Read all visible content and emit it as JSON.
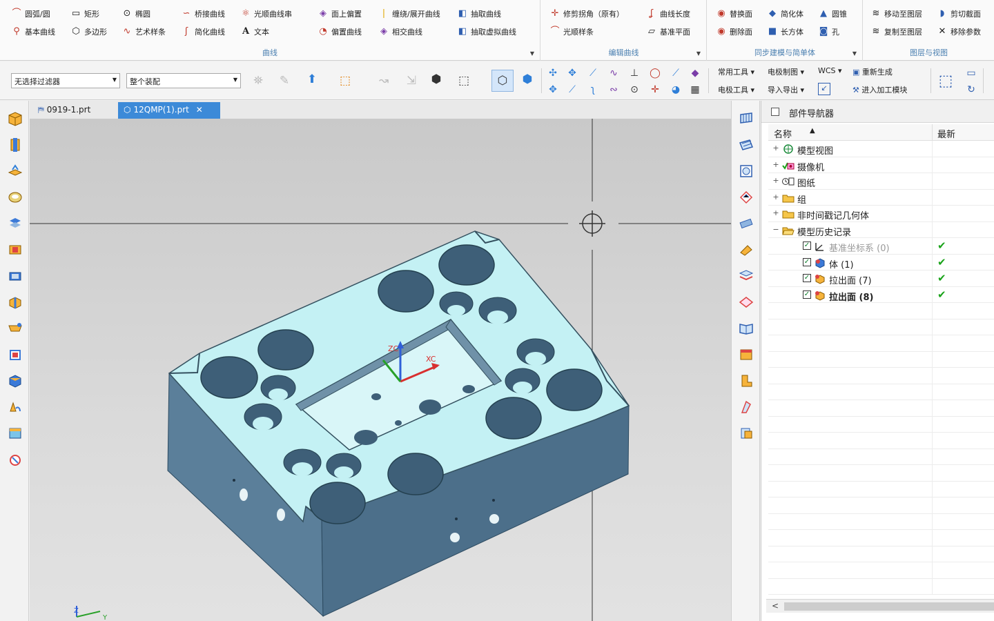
{
  "ribbon": {
    "groups": [
      {
        "title": "曲线",
        "row1": [
          "圆弧/圆",
          "矩形",
          "椭圆",
          "桥接曲线",
          "光顺曲线串",
          "面上偏置",
          "缠绕/展开曲线",
          "抽取曲线"
        ],
        "row2": [
          "基本曲线",
          "多边形",
          "艺术样条",
          "简化曲线",
          "文本",
          "偏置曲线",
          "相交曲线",
          "抽取虚拟曲线"
        ]
      },
      {
        "title": "编辑曲线",
        "row1": [
          "修剪拐角（原有）",
          "曲线长度"
        ],
        "row2": [
          "光顺样条",
          "基准平面"
        ]
      },
      {
        "title": "同步建模与简单体",
        "row1": [
          "替换面",
          "简化体",
          "圆锥"
        ],
        "row2": [
          "删除面",
          "长方体",
          "孔"
        ]
      },
      {
        "title": "图层与视图",
        "row1": [
          "移动至图层",
          "剪切截面"
        ],
        "row2": [
          "复制至图层",
          "移除参数"
        ]
      }
    ]
  },
  "toolbar": {
    "filter_combo": "无选择过滤器",
    "scope_combo": "整个装配",
    "menus_row1": [
      "常用工具",
      "电极制图",
      "WCS"
    ],
    "menus_row2": [
      "电极工具",
      "导入导出"
    ],
    "regen_label": "重新生成",
    "enter_machining_label": "进入加工模块"
  },
  "tabs": [
    {
      "label": "0919-1.prt",
      "active": false
    },
    {
      "label": "12QMP(1).prt",
      "active": true,
      "close": "✕"
    }
  ],
  "viewport": {
    "axis_zc": "ZC",
    "axis_xc": "XC",
    "corner_z": "Z",
    "corner_y": "Y"
  },
  "navigator": {
    "title": "部件导航器",
    "col_name": "名称",
    "col_latest": "最新",
    "sort_glyph": "▲",
    "rows": [
      {
        "indent": 0,
        "expand": "+",
        "label": "模型视图",
        "icon": "model-views-icon",
        "style": "",
        "checkbox": false,
        "ok": false
      },
      {
        "indent": 0,
        "expand": "+",
        "label": "摄像机",
        "icon": "camera-icon",
        "style": "",
        "checkbox": false,
        "ok": false
      },
      {
        "indent": 0,
        "expand": "+",
        "label": "图纸",
        "icon": "drawing-icon",
        "style": "",
        "checkbox": false,
        "ok": false
      },
      {
        "indent": 0,
        "expand": "+",
        "label": "组",
        "icon": "folder-icon",
        "style": "",
        "checkbox": false,
        "ok": false
      },
      {
        "indent": 0,
        "expand": "+",
        "label": "非时间戳记几何体",
        "icon": "folder-icon",
        "style": "",
        "checkbox": false,
        "ok": false
      },
      {
        "indent": 0,
        "expand": "−",
        "label": "模型历史记录",
        "icon": "folder-open-icon",
        "style": "",
        "checkbox": false,
        "ok": false
      },
      {
        "indent": 1,
        "expand": "",
        "label": "基准坐标系 (0)",
        "icon": "datum-csys-icon",
        "style": "grey",
        "checkbox": true,
        "ok": true
      },
      {
        "indent": 1,
        "expand": "",
        "label": "体 (1)",
        "icon": "body-icon",
        "style": "",
        "checkbox": true,
        "ok": true
      },
      {
        "indent": 1,
        "expand": "",
        "label": "拉出面 (7)",
        "icon": "pull-face-icon",
        "style": "",
        "checkbox": true,
        "ok": true
      },
      {
        "indent": 1,
        "expand": "",
        "label": "拉出面 (8)",
        "icon": "pull-face-icon",
        "style": "bold",
        "checkbox": true,
        "ok": true
      }
    ],
    "scroll_left": "<"
  },
  "colors": {
    "accent": "#3c8ad8",
    "group_title": "#4a7fb0",
    "part_top": "#c4f1f4",
    "part_side": "#5b7f9a",
    "ok_green": "#1aa31a"
  }
}
